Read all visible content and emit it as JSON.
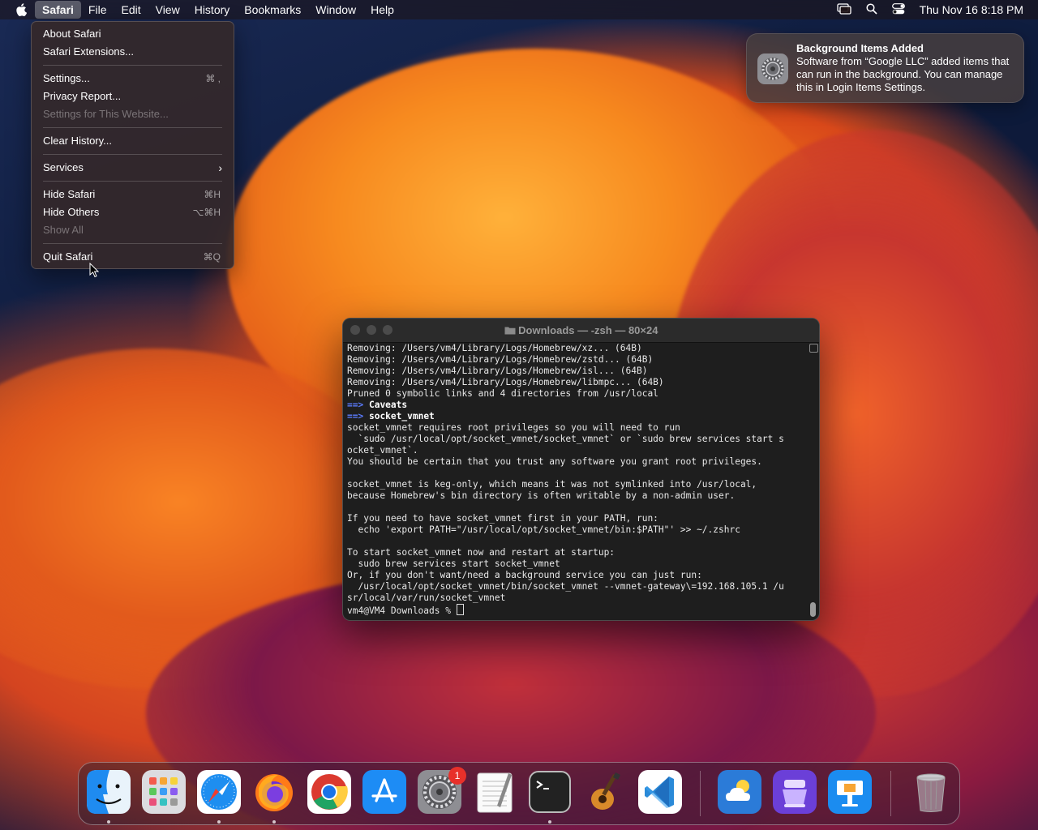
{
  "menubar": {
    "app_name": "Safari",
    "items": [
      "File",
      "Edit",
      "View",
      "History",
      "Bookmarks",
      "Window",
      "Help"
    ],
    "clock": "Thu Nov 16  8:18 PM"
  },
  "app_menu": {
    "about": "About Safari",
    "extensions": "Safari Extensions...",
    "settings": "Settings...",
    "settings_sc": "⌘ ,",
    "privacy": "Privacy Report...",
    "site_settings": "Settings for This Website...",
    "clear_history": "Clear History...",
    "services": "Services",
    "hide": "Hide Safari",
    "hide_sc": "⌘H",
    "hide_others": "Hide Others",
    "hide_others_sc": "⌥⌘H",
    "show_all": "Show All",
    "quit": "Quit Safari",
    "quit_sc": "⌘Q"
  },
  "notification": {
    "title": "Background Items Added",
    "body": "Software from “Google LLC” added items that can run in the background. You can manage this in Login Items Settings."
  },
  "terminal": {
    "title": "Downloads — -zsh — 80×24",
    "lines": [
      "Removing: /Users/vm4/Library/Logs/Homebrew/xz... (64B)",
      "Removing: /Users/vm4/Library/Logs/Homebrew/zstd... (64B)",
      "Removing: /Users/vm4/Library/Logs/Homebrew/isl... (64B)",
      "Removing: /Users/vm4/Library/Logs/Homebrew/libmpc... (64B)",
      "Pruned 0 symbolic links and 4 directories from /usr/local"
    ],
    "arrow": "==>",
    "caveats": "Caveats",
    "pkg": "socket_vmnet",
    "lines2": [
      "socket_vmnet requires root privileges so you will need to run",
      "  `sudo /usr/local/opt/socket_vmnet/socket_vmnet` or `sudo brew services start s",
      "ocket_vmnet`.",
      "You should be certain that you trust any software you grant root privileges.",
      "",
      "socket_vmnet is keg-only, which means it was not symlinked into /usr/local,",
      "because Homebrew's bin directory is often writable by a non-admin user.",
      "",
      "If you need to have socket_vmnet first in your PATH, run:",
      "  echo 'export PATH=\"/usr/local/opt/socket_vmnet/bin:$PATH\"' >> ~/.zshrc",
      "",
      "To start socket_vmnet now and restart at startup:",
      "  sudo brew services start socket_vmnet",
      "Or, if you don't want/need a background service you can just run:",
      "  /usr/local/opt/socket_vmnet/bin/socket_vmnet --vmnet-gateway\\=192.168.105.1 /u",
      "sr/local/var/run/socket_vmnet"
    ],
    "prompt": "vm4@VM4 Downloads % "
  },
  "dock": {
    "settings_badge": "1",
    "apps": [
      "finder-icon",
      "launchpad-icon",
      "safari-icon",
      "firefox-icon",
      "chrome-icon",
      "app-store-icon",
      "system-settings-icon",
      "textedit-icon",
      "terminal-icon",
      "garageband-icon",
      "vscode-icon",
      "weather-icon",
      "apple-configurator-icon",
      "keynote-icon",
      "trash-icon"
    ]
  }
}
